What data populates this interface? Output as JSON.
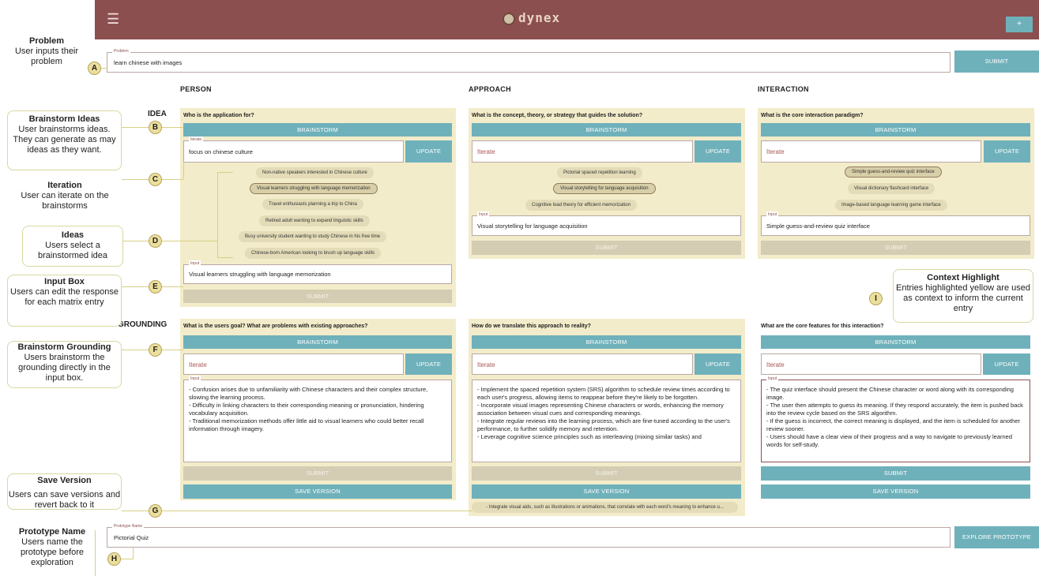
{
  "app": {
    "logo": "dynex",
    "menu_icon": "hamburger-icon",
    "plus_label": "+"
  },
  "problem": {
    "legend": "Problem",
    "value": "learn chinese with images",
    "submit": "SUBMIT"
  },
  "columns": {
    "person": "PERSON",
    "approach": "APPROACH",
    "interaction": "INTERACTION"
  },
  "rows": {
    "idea": "IDEA",
    "grounding": "GROUNDING"
  },
  "labels": {
    "brainstorm": "BRAINSTORM",
    "update": "UPDATE",
    "submit": "SUBMIT",
    "save_version": "SAVE VERSION",
    "iterate_legend": "Iterate",
    "iterate_placeholder": "Iterate",
    "input_legend": "Input"
  },
  "idea_person": {
    "question": "Who is the application for?",
    "iterate_value": "focus on chinese culture",
    "ideas": [
      "Non-native speakers interested in Chinese culture",
      "Visual learners struggling with language memorization",
      "Travel enthusiasts planning a trip to China",
      "Retired adult wanting to expand linguistic skills",
      "Busy university student wanting to study Chinese in his free time",
      "Chinese-born American looking to brush up language skills"
    ],
    "selected": 1,
    "input": "Visual learners struggling with language memorization"
  },
  "idea_approach": {
    "question": "What is the concept, theory, or strategy that guides the solution?",
    "ideas": [
      "Pictorial spaced repetition learning",
      "Visual storytelling for language acquisition",
      "Cognitive load theory for efficient memorization"
    ],
    "selected": 1,
    "input": "Visual storytelling for language acquisition"
  },
  "idea_interaction": {
    "question": "What is the core interaction paradigm?",
    "ideas": [
      "Simple guess-and-review quiz interface",
      "Visual dictionary flashcard interface",
      "Image-based language learning game interface"
    ],
    "selected": 0,
    "input": "Simple guess-and-review quiz interface"
  },
  "ground_person": {
    "question": "What is the users goal? What are problems with existing approaches?",
    "input": "- Confusion arises due to unfamiliarity with Chinese characters and their complex structure, slowing the learning process.\n- Difficulty in linking characters to their corresponding meaning or pronunciation, hindering vocabulary acquisition.\n- Traditional memorization methods offer little aid to visual learners who could better recall information through imagery."
  },
  "ground_approach": {
    "question": "How do we translate this approach to reality?",
    "input": "- Implement the spaced repetition system (SRS) algorithm to schedule review times according to each user's progress, allowing items to reappear before they're likely to be forgotten.\n- Incorporate visual images representing Chinese characters or words, enhancing the memory association between visual cues and corresponding meanings.\n- Integrate regular reviews into the learning process, which are fine-tuned according to the user's performance, to further solidify memory and retention.\n- Leverage cognitive science principles such as interleaving (mixing similar tasks) and",
    "saved": "- Integrate visual aids, such as illustrations or animations, that correlate with each word's meaning to enhance u..."
  },
  "ground_interaction": {
    "question": "What are the core features for this interaction?",
    "input": "- The quiz interface should present the Chinese character or word along with its corresponding image.\n- The user then attempts to guess its meaning. If they respond accurately, the item is pushed back into the review cycle based on the SRS algorithm.\n- If the guess is incorrect, the correct meaning is displayed, and the item is scheduled for another review sooner.\n- Users should have a clear view of their progress and a way to navigate to previously learned words for self-study."
  },
  "prototype": {
    "legend": "Prototype Name",
    "value": "Pictorial Quiz",
    "explore": "EXPLORE PROTOTYPE"
  },
  "annotations": {
    "A": {
      "badge": "A",
      "title": "Problem",
      "body": "User inputs their problem"
    },
    "B": {
      "badge": "B",
      "title": "Brainstorm Ideas",
      "body": "User brainstorms ideas. They can generate as may ideas as they want."
    },
    "C": {
      "badge": "C",
      "title": "Iteration",
      "body": "User can iterate on the brainstorms"
    },
    "D": {
      "badge": "D",
      "title": "Ideas",
      "body": "Users select a brainstormed idea"
    },
    "E": {
      "badge": "E",
      "title": "Input Box",
      "body": "Users can edit the response for each matrix entry"
    },
    "F": {
      "badge": "F",
      "title": "Brainstorm Grounding",
      "body": "Users brainstorm the grounding directly in the input box."
    },
    "G": {
      "badge": "G",
      "title": "Save Version",
      "body": "Users can save versions and revert back to it"
    },
    "H": {
      "badge": "H",
      "title": "Prototype Name",
      "body": "Users name the prototype before exploration"
    },
    "I": {
      "badge": "I",
      "title": "Context Highlight",
      "body": "Entries  highlighted yellow are used as context to inform the current entry"
    }
  },
  "colors": {
    "topbar": "#8c4f4f",
    "teal": "#6fb1bb",
    "card": "#f3ecca",
    "highlight_border": "#8c4f4f"
  }
}
